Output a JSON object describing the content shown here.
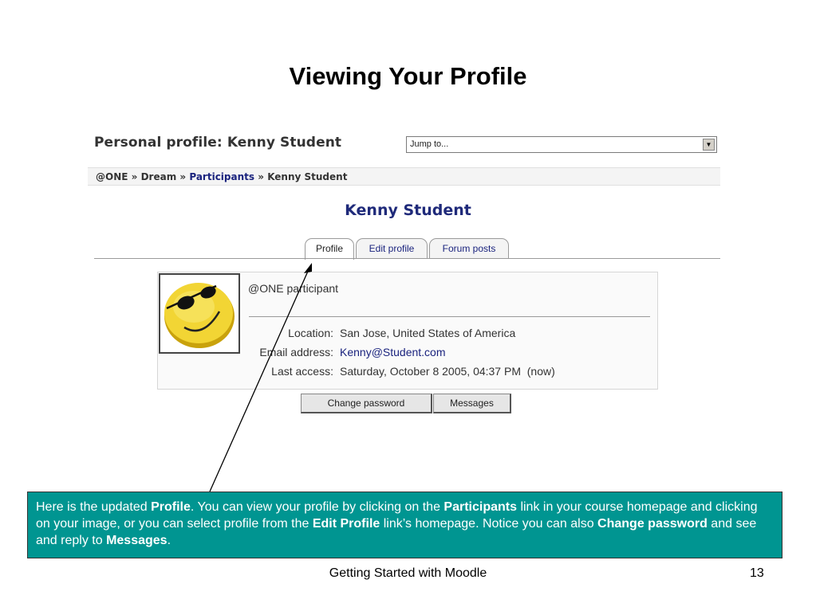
{
  "slide": {
    "title": "Viewing Your Profile",
    "footer": "Getting Started with Moodle",
    "page_number": "13"
  },
  "moodle": {
    "header_title": "Personal profile: Kenny Student",
    "jump_to": {
      "value": "Jump to..."
    },
    "breadcrumb": [
      "@ONE",
      "Dream",
      "Participants",
      "Kenny Student"
    ],
    "breadcrumb_sep": "»",
    "user_name": "Kenny Student",
    "tabs": [
      {
        "label": "Profile",
        "active": true
      },
      {
        "label": "Edit profile",
        "active": false
      },
      {
        "label": "Forum posts",
        "active": false
      }
    ],
    "profile": {
      "role": "@ONE participant",
      "fields": [
        {
          "label": "Location:",
          "value": "San Jose, United States of America"
        },
        {
          "label": "Email address:",
          "value": "Kenny@Student.com"
        },
        {
          "label": "Last access:",
          "value": "Saturday, October 8 2005, 04:37 PM  (now)"
        }
      ],
      "avatar_icon": "smiley-sunglasses-icon"
    },
    "buttons": {
      "change_password": "Change password",
      "messages": "Messages"
    }
  },
  "callout": {
    "segments": [
      {
        "text": "Here is the updated ",
        "bold": false
      },
      {
        "text": "Profile",
        "bold": true
      },
      {
        "text": ". You can view your profile by clicking on the ",
        "bold": false
      },
      {
        "text": "Participants",
        "bold": true
      },
      {
        "text": " link in your course homepage and clicking on your  image, or you can select profile from the ",
        "bold": false
      },
      {
        "text": "Edit Profile",
        "bold": true
      },
      {
        "text": " link’s homepage. Notice you can also ",
        "bold": false
      },
      {
        "text": "Change password",
        "bold": true
      },
      {
        "text": " and see and reply to ",
        "bold": false
      },
      {
        "text": "Messages",
        "bold": true
      },
      {
        "text": ".",
        "bold": false
      }
    ]
  },
  "colors": {
    "callout_bg": "#009591",
    "link": "#1a237e",
    "name_heading": "#1f2a7a"
  }
}
